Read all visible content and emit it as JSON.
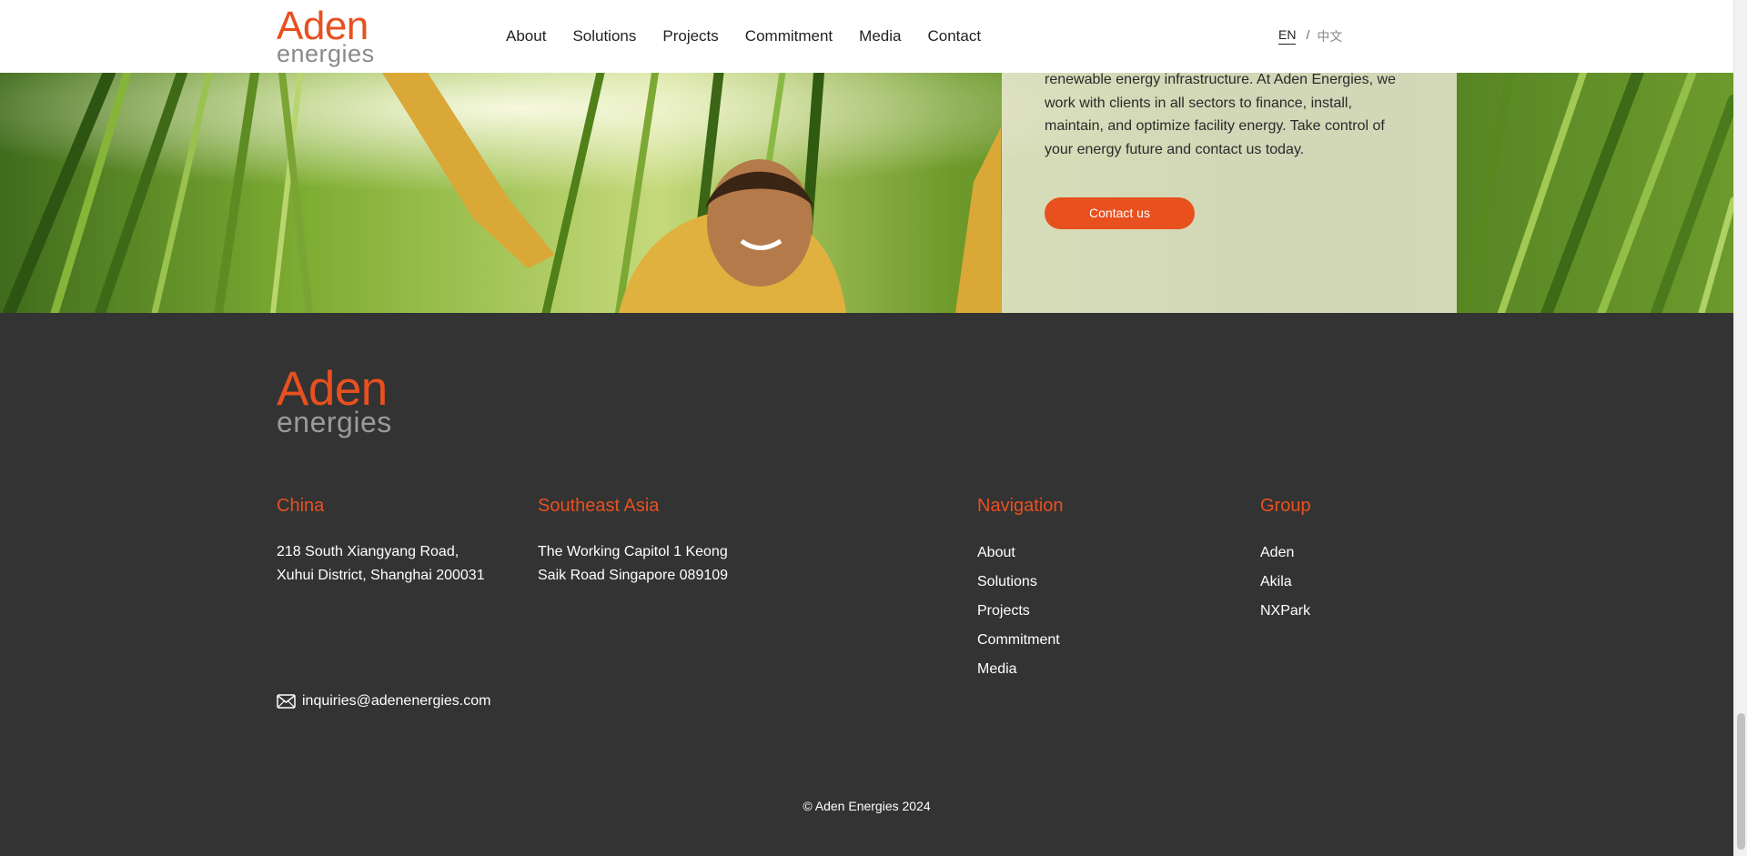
{
  "header": {
    "logo": {
      "line1": "Aden",
      "line2": "energies"
    },
    "nav": [
      "About",
      "Solutions",
      "Projects",
      "Commitment",
      "Media",
      "Contact"
    ],
    "lang": {
      "en": "EN",
      "separator": "/",
      "zh": "中文"
    }
  },
  "hero": {
    "text": "renewable energy infrastructure. At Aden Energies, we work with clients in all sectors to finance, install, maintain, and optimize facility energy. Take control of your energy future and contact us today.",
    "cta": "Contact us"
  },
  "footer": {
    "logo": {
      "line1": "Aden",
      "line2": "energies"
    },
    "china": {
      "title": "China",
      "line1": "218 South Xiangyang Road,",
      "line2": "Xuhui District, Shanghai 200031"
    },
    "sea": {
      "title": "Southeast Asia",
      "line1": "The Working Capitol 1 Keong",
      "line2": "Saik Road Singapore 089109"
    },
    "navigation": {
      "title": "Navigation",
      "items": [
        "About",
        "Solutions",
        "Projects",
        "Commitment",
        "Media"
      ]
    },
    "group": {
      "title": "Group",
      "items": [
        "Aden",
        "Akila",
        "NXPark"
      ]
    },
    "email": "inquiries@adenenergies.com",
    "copyright": "© Aden Energies 2024"
  },
  "colors": {
    "accent": "#e8501f",
    "footer_bg": "#333333",
    "header_bg": "#ffffff"
  }
}
